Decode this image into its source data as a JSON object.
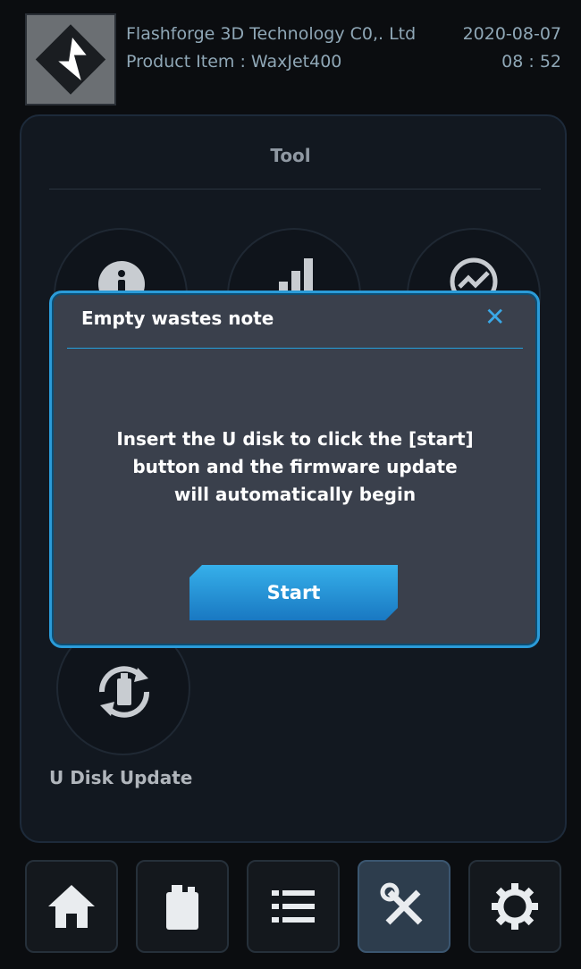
{
  "header": {
    "company": "Flashforge 3D Technology C0,. Ltd",
    "product": "Product Item : WaxJet400",
    "date": "2020-08-07",
    "time": "08 : 52"
  },
  "panel": {
    "title": "Tool",
    "tools": [
      {
        "icon": "info-icon"
      },
      {
        "icon": "bar-chart-icon"
      },
      {
        "icon": "trend-icon"
      }
    ],
    "u_disk_update": {
      "label": "U Disk Update",
      "icon": "usb-sync-icon"
    }
  },
  "modal": {
    "title": "Empty wastes note",
    "close": "✕",
    "message": "Insert the U disk to click the [start]\nbutton and the firmware update\nwill automatically begin",
    "start_label": "Start"
  },
  "nav": {
    "items": [
      {
        "name": "home",
        "icon": "home-icon",
        "active": false
      },
      {
        "name": "material",
        "icon": "material-box-icon",
        "active": false
      },
      {
        "name": "list",
        "icon": "list-icon",
        "active": false
      },
      {
        "name": "tools",
        "icon": "tools-icon",
        "active": true
      },
      {
        "name": "settings",
        "icon": "gear-icon",
        "active": false
      }
    ]
  },
  "colors": {
    "accent": "#2b9bd8",
    "button": "#1f8fd4",
    "modal_bg": "#3a404c"
  }
}
